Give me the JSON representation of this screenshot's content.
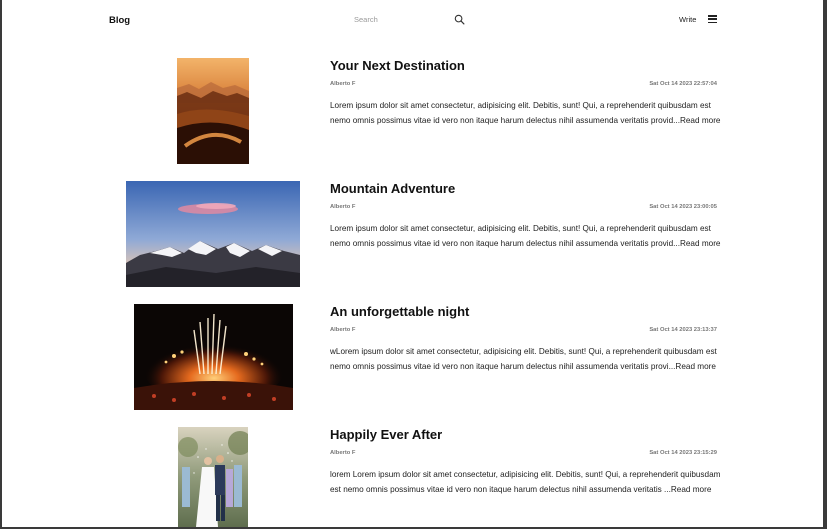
{
  "header": {
    "brand": "Blog",
    "search_placeholder": "Search",
    "write_label": "Write"
  },
  "icons": {
    "search": "search-icon",
    "menu": "hamburger-menu-icon"
  },
  "posts": [
    {
      "title": "Your Next Destination",
      "author": "Alberto F",
      "date": "Sat Oct 14 2023  22:57:04",
      "excerpt": "Lorem ipsum dolor sit amet consectetur, adipisicing elit. Debitis, sunt! Qui, a reprehenderit quibusdam est nemo omnis possimus vitae id vero non itaque harum delectus nihil assumenda veritatis provid...",
      "read_more": "Read more"
    },
    {
      "title": "Mountain Adventure",
      "author": "Alberto F",
      "date": "Sat Oct 14 2023  23:00:05",
      "excerpt": "Lorem ipsum dolor sit amet consectetur, adipisicing elit. Debitis, sunt! Qui, a reprehenderit quibusdam est nemo omnis possimus vitae id vero non itaque harum delectus nihil assumenda veritatis provid...",
      "read_more": "Read more"
    },
    {
      "title": "An unforgettable night",
      "author": "Alberto F",
      "date": "Sat Oct 14 2023  23:13:37",
      "excerpt": "wLorem ipsum dolor sit amet consectetur, adipisicing elit. Debitis, sunt! Qui, a reprehenderit quibusdam est nemo omnis possimus vitae id vero non itaque harum delectus nihil assumenda veritatis provi...",
      "read_more": "Read more"
    },
    {
      "title": "Happily Ever After",
      "author": "Alberto F",
      "date": "Sat Oct 14 2023  23:15:29",
      "excerpt": "lorem Lorem ipsum dolor sit amet consectetur, adipisicing elit. Debitis, sunt! Qui, a reprehenderit quibusdam est nemo omnis possimus vitae id vero non itaque harum delectus nihil assumenda veritatis ...",
      "read_more": "Read more"
    }
  ]
}
